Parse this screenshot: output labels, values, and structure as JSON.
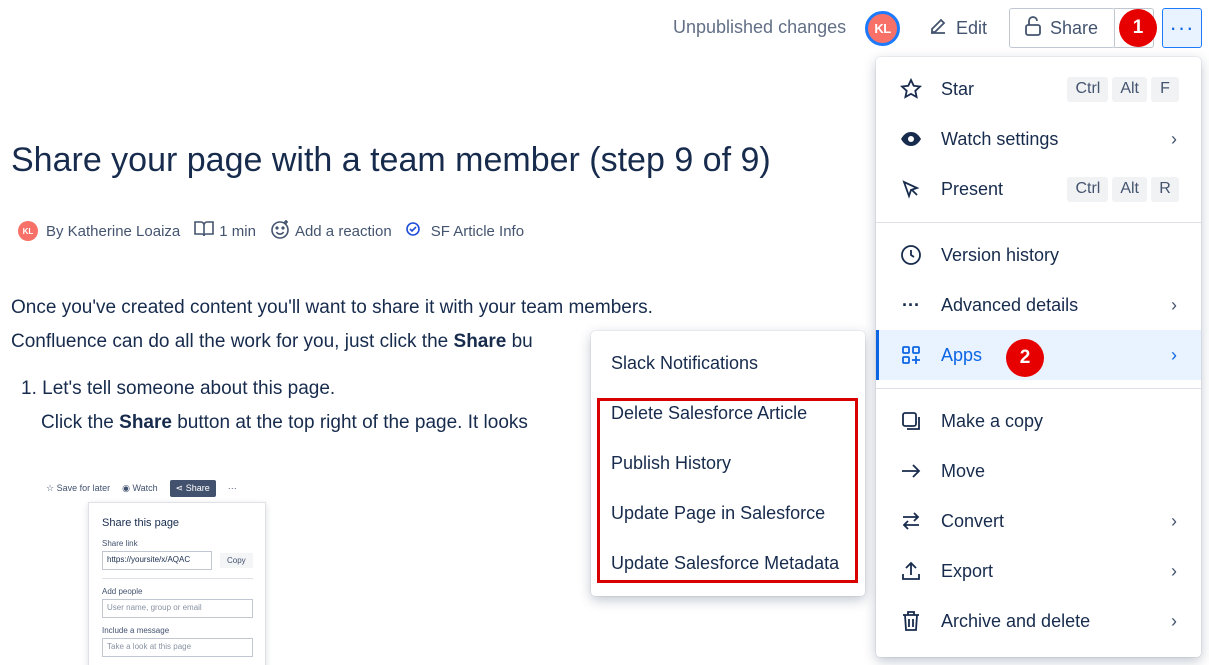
{
  "header": {
    "unpublished": "Unpublished changes",
    "avatar_initials": "KL",
    "edit_label": "Edit",
    "share_label": "Share",
    "more_label": "···",
    "badge_1": "1",
    "badge_2": "2",
    "accent_color": "#0c66e4",
    "badge_color": "#e60000"
  },
  "page": {
    "title": "Share your page with a team member (step 9 of 9)",
    "byline": {
      "avatar_initials": "KL",
      "author": "By Katherine Loaiza",
      "read_time": "1 min",
      "reaction": "Add a reaction",
      "sf_info": "SF Article Info"
    },
    "para1": "Once you've created content you'll want to share it with your team members.",
    "para2_pre": "Confluence can do all the work for you, just click the ",
    "para2_bold": "Share",
    "para2_post": " bu",
    "list1": "1. Let's tell someone about this page.",
    "list2_pre": "Click the ",
    "list2_bold": "Share",
    "list2_post": " button at the top right of the page. It looks"
  },
  "thumb": {
    "save_for_later": "Save for later",
    "watch": "Watch",
    "share": "Share",
    "more": "···",
    "card_title": "Share this page",
    "share_link_label": "Share link",
    "share_link_value": "https://yoursite/x/AQAC",
    "copy": "Copy",
    "add_people_label": "Add people",
    "add_people_placeholder": "User name, group or email",
    "message_label": "Include a message",
    "message_placeholder": "Take a look at this page"
  },
  "menu": {
    "star": "Star",
    "star_keys": [
      "Ctrl",
      "Alt",
      "F"
    ],
    "watch_settings": "Watch settings",
    "present": "Present",
    "present_keys": [
      "Ctrl",
      "Alt",
      "R"
    ],
    "version_history": "Version history",
    "advanced_details": "Advanced details",
    "apps": "Apps",
    "make_copy": "Make a copy",
    "move": "Move",
    "convert": "Convert",
    "export": "Export",
    "archive_delete": "Archive and delete"
  },
  "submenu": {
    "items": [
      "Slack Notifications",
      "Delete Salesforce Article",
      "Publish History",
      "Update Page in Salesforce",
      "Update Salesforce Metadata"
    ]
  }
}
